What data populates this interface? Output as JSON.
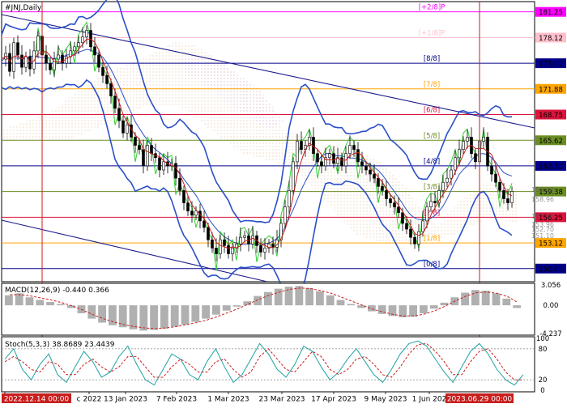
{
  "symbol": "#JNJ,Daily",
  "price_tags": [
    {
      "value": "181.25",
      "color": "#ff00ff"
    },
    {
      "value": "178.12",
      "color": "#ffc0cb"
    },
    {
      "value": "175.00",
      "color": "#00008b"
    },
    {
      "value": "171.88",
      "color": "#ffa500"
    },
    {
      "value": "168.75",
      "color": "#dc143c"
    },
    {
      "value": "165.62",
      "color": "#6b8e23"
    },
    {
      "value": "162.50",
      "color": "#00008b"
    },
    {
      "value": "159.38",
      "color": "#6b8e23"
    },
    {
      "value": "156.25",
      "color": "#dc143c"
    },
    {
      "value": "153.12",
      "color": "#ffa500"
    },
    {
      "value": "150.00",
      "color": "#00008b"
    }
  ],
  "murrey_labels": [
    "[+2/8]P",
    "[+1/8]P",
    "[8/8]",
    "[7/8]",
    "[6/8]",
    "[5/8]",
    "[4/8]",
    "[3/8]",
    "[2/8]",
    "[1/8]",
    "[0/8]"
  ],
  "partial_tags": [
    "159.93",
    "158.96",
    "157.56",
    "153.96",
    "152.70",
    "151.10"
  ],
  "macd": {
    "label": "MACD(12,26,9) -0.440 0.366",
    "ticks": [
      "3.056",
      "0.00",
      "-4.237"
    ]
  },
  "stoch": {
    "label": "Stoch(5,3,3) 38.8689 23.4439",
    "ticks": [
      "100",
      "80",
      "20",
      "0"
    ]
  },
  "time_axis": {
    "labels": [
      "28",
      "c 2022",
      "13 Jan 2023",
      "7 Feb 2023",
      "1 Mar 2023",
      "23 Mar 2023",
      "17 Apr 2023",
      "9 May 2023",
      "1 Jun 202"
    ],
    "highlight_left": "2022.12.14 00:00",
    "highlight_right": "2023.06.29 00:00"
  },
  "chart_data": {
    "type": "candlestick",
    "title": "#JNJ,Daily",
    "ylim": [
      148.4,
      182.5
    ],
    "overlays": [
      "Bollinger Bands",
      "moving average",
      "Ichimoku cloud",
      "Murrey Math lines",
      "channel lines"
    ],
    "close_path": [
      [
        0,
        175.5
      ],
      [
        5,
        176.2
      ],
      [
        10,
        174.0
      ],
      [
        15,
        177.5
      ],
      [
        20,
        176.0
      ],
      [
        25,
        174.5
      ],
      [
        30,
        175.8
      ],
      [
        35,
        174.3
      ],
      [
        40,
        176.5
      ],
      [
        45,
        178.3
      ],
      [
        50,
        176.0
      ],
      [
        55,
        175.0
      ],
      [
        60,
        174.2
      ],
      [
        65,
        175.5
      ],
      [
        70,
        176.0
      ],
      [
        75,
        175.0
      ],
      [
        80,
        175.8
      ],
      [
        85,
        176.5
      ],
      [
        90,
        177.0
      ],
      [
        95,
        177.5
      ],
      [
        100,
        178.2
      ],
      [
        105,
        179.0
      ],
      [
        110,
        177.0
      ],
      [
        115,
        176.0
      ],
      [
        120,
        174.5
      ],
      [
        125,
        173.5
      ],
      [
        130,
        172.5
      ],
      [
        135,
        171.0
      ],
      [
        140,
        169.5
      ],
      [
        145,
        168.0
      ],
      [
        150,
        166.5
      ],
      [
        155,
        167.5
      ],
      [
        160,
        166.0
      ],
      [
        165,
        165.0
      ],
      [
        170,
        164.5
      ],
      [
        175,
        162.5
      ],
      [
        180,
        165.0
      ],
      [
        185,
        164.0
      ],
      [
        190,
        163.5
      ],
      [
        195,
        162.0
      ],
      [
        200,
        163.0
      ],
      [
        205,
        162.5
      ],
      [
        210,
        162.8
      ],
      [
        215,
        161.0
      ],
      [
        220,
        159.5
      ],
      [
        225,
        158.0
      ],
      [
        230,
        157.0
      ],
      [
        235,
        156.5
      ],
      [
        240,
        157.0
      ],
      [
        245,
        155.8
      ],
      [
        250,
        155.0
      ],
      [
        255,
        153.5
      ],
      [
        260,
        152.5
      ],
      [
        265,
        151.8
      ],
      [
        270,
        153.5
      ],
      [
        275,
        152.8
      ],
      [
        280,
        151.8
      ],
      [
        285,
        152.5
      ],
      [
        290,
        153.0
      ],
      [
        295,
        153.8
      ],
      [
        300,
        154.0
      ],
      [
        305,
        153.0
      ],
      [
        310,
        154.0
      ],
      [
        315,
        152.8
      ],
      [
        320,
        152.0
      ],
      [
        325,
        152.5
      ],
      [
        330,
        153.0
      ],
      [
        335,
        152.6
      ],
      [
        340,
        153.5
      ],
      [
        345,
        155.5
      ],
      [
        350,
        157.5
      ],
      [
        355,
        159.5
      ],
      [
        360,
        163.0
      ],
      [
        365,
        165.5
      ],
      [
        370,
        164.5
      ],
      [
        375,
        165.0
      ],
      [
        380,
        166.0
      ],
      [
        385,
        164.0
      ],
      [
        390,
        163.0
      ],
      [
        395,
        162.5
      ],
      [
        400,
        163.5
      ],
      [
        405,
        164.0
      ],
      [
        410,
        162.8
      ],
      [
        415,
        163.5
      ],
      [
        420,
        162.5
      ],
      [
        425,
        164.0
      ],
      [
        430,
        165.0
      ],
      [
        435,
        164.5
      ],
      [
        440,
        163.0
      ],
      [
        445,
        162.5
      ],
      [
        450,
        162.0
      ],
      [
        455,
        161.5
      ],
      [
        460,
        161.0
      ],
      [
        465,
        160.0
      ],
      [
        470,
        159.5
      ],
      [
        475,
        158.5
      ],
      [
        480,
        158.0
      ],
      [
        485,
        157.5
      ],
      [
        490,
        156.8
      ],
      [
        495,
        155.5
      ],
      [
        500,
        154.8
      ],
      [
        505,
        153.8
      ],
      [
        510,
        153.0
      ],
      [
        515,
        154.5
      ],
      [
        520,
        155.8
      ],
      [
        525,
        157.5
      ],
      [
        530,
        158.2
      ],
      [
        535,
        158.0
      ],
      [
        540,
        159.5
      ],
      [
        545,
        160.5
      ],
      [
        550,
        161.0
      ],
      [
        555,
        162.0
      ],
      [
        560,
        163.5
      ],
      [
        565,
        164.5
      ],
      [
        570,
        165.5
      ],
      [
        575,
        166.0
      ],
      [
        580,
        164.0
      ],
      [
        585,
        163.0
      ],
      [
        590,
        165.5
      ],
      [
        595,
        166.0
      ],
      [
        600,
        162.5
      ],
      [
        605,
        161.5
      ],
      [
        610,
        160.5
      ],
      [
        615,
        159.5
      ],
      [
        620,
        158.5
      ],
      [
        625,
        158.0
      ],
      [
        630,
        159.4
      ]
    ],
    "macd_range": [
      -4.237,
      3.056
    ],
    "macd_bars": [
      1.5,
      1.8,
      1.2,
      0.8,
      0.5,
      0.2,
      -0.4,
      -1.2,
      -2.0,
      -2.6,
      -3.0,
      -3.3,
      -3.6,
      -3.8,
      -3.7,
      -3.5,
      -3.2,
      -2.9,
      -2.5,
      -2.0,
      -1.4,
      -0.8,
      -0.2,
      0.6,
      1.4,
      2.0,
      2.5,
      2.8,
      2.9,
      2.6,
      2.1,
      1.5,
      0.8,
      0.2,
      -0.4,
      -0.9,
      -1.3,
      -1.6,
      -1.8,
      -1.7,
      -1.2,
      -0.5,
      0.4,
      1.2,
      1.9,
      2.3,
      2.2,
      1.8,
      1.0,
      -0.4
    ],
    "macd_signal": [
      1.6,
      1.6,
      1.4,
      1.1,
      0.8,
      0.4,
      -0.1,
      -0.7,
      -1.4,
      -2.0,
      -2.5,
      -2.9,
      -3.2,
      -3.4,
      -3.5,
      -3.4,
      -3.2,
      -2.9,
      -2.6,
      -2.2,
      -1.7,
      -1.1,
      -0.5,
      0.2,
      0.9,
      1.5,
      2.0,
      2.4,
      2.6,
      2.5,
      2.2,
      1.8,
      1.2,
      0.6,
      0.0,
      -0.6,
      -1.0,
      -1.4,
      -1.6,
      -1.6,
      -1.3,
      -0.8,
      -0.1,
      0.7,
      1.4,
      1.9,
      2.0,
      1.8,
      1.3,
      0.4
    ],
    "stoch_k": [
      60,
      80,
      40,
      20,
      50,
      70,
      30,
      15,
      45,
      75,
      55,
      25,
      35,
      65,
      85,
      50,
      20,
      10,
      40,
      70,
      60,
      30,
      20,
      55,
      80,
      45,
      15,
      30,
      60,
      90,
      70,
      40,
      25,
      50,
      85,
      75,
      45,
      20,
      35,
      60,
      80,
      55,
      30,
      15,
      40,
      70,
      90,
      95,
      85,
      60,
      35,
      15,
      45,
      75,
      90,
      70,
      40,
      20,
      10,
      30
    ],
    "stoch_d": [
      55,
      65,
      55,
      40,
      35,
      55,
      50,
      30,
      30,
      50,
      60,
      45,
      35,
      45,
      65,
      65,
      45,
      25,
      25,
      45,
      60,
      50,
      35,
      35,
      55,
      60,
      40,
      25,
      35,
      65,
      80,
      60,
      40,
      35,
      55,
      75,
      65,
      40,
      30,
      40,
      60,
      65,
      50,
      30,
      25,
      45,
      70,
      88,
      90,
      75,
      55,
      30,
      30,
      55,
      75,
      80,
      60,
      35,
      20,
      20
    ]
  }
}
